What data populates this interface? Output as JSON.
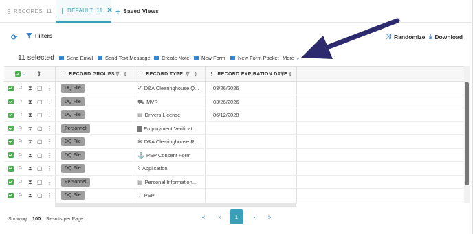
{
  "tabs": {
    "records": {
      "label": "RECORDS",
      "count": "11"
    },
    "default": {
      "label": "DEFAULT",
      "count": "11",
      "close": "✕"
    },
    "saved_views": {
      "label": "Saved Views"
    }
  },
  "toolbar": {
    "filters_label": "Filters",
    "randomize_label": "Randomize",
    "download_label": "Download"
  },
  "selection": {
    "selected_text": "11 selected",
    "actions": [
      "Send Email",
      "Send Text Message",
      "Create Note",
      "New Form",
      "New Form Packet"
    ],
    "more_label": "More"
  },
  "columns": {
    "record_groups": "RECORD GROUPS",
    "record_type": "RECORD TYPE",
    "record_expiration_date": "RECORD EXPIRATION DATE"
  },
  "rows": [
    {
      "group": "DQ File",
      "type": "D&A Clearinghouse Q...",
      "type_icon": "check-icon",
      "date": "03/26/2026"
    },
    {
      "group": "DQ File",
      "type": "MVR",
      "type_icon": "truck-icon",
      "date": "03/26/2026"
    },
    {
      "group": "DQ File",
      "type": "Drivers License",
      "type_icon": "id-card-icon",
      "date": "06/12/2028"
    },
    {
      "group": "Personnel",
      "type": "Employment Verificat...",
      "type_icon": "document-icon",
      "date": ""
    },
    {
      "group": "DQ File",
      "type": "D&A Clearinghouse R...",
      "type_icon": "asterisk-icon",
      "date": ""
    },
    {
      "group": "DQ File",
      "type": "PSP Consent Form",
      "type_icon": "anchor-icon",
      "date": ""
    },
    {
      "group": "DQ File",
      "type": "Application",
      "type_icon": "paperclip-icon",
      "date": ""
    },
    {
      "group": "Personnel",
      "type": "Personal Information...",
      "type_icon": "id-card-icon",
      "date": ""
    },
    {
      "group": "DQ File",
      "type": "PSP",
      "type_icon": "chevron-down-icon",
      "date": ""
    }
  ],
  "footer": {
    "showing_label": "Showing",
    "per_page": "100",
    "results_label": "Results per Page",
    "first": "«",
    "prev": "‹",
    "current_page": "1",
    "next": "›",
    "last": "»"
  },
  "colors": {
    "accent": "#3aa0b8",
    "link_blue": "#3a86c8",
    "check_green": "#4caf50",
    "arrow_navy": "#2e2a6e"
  }
}
